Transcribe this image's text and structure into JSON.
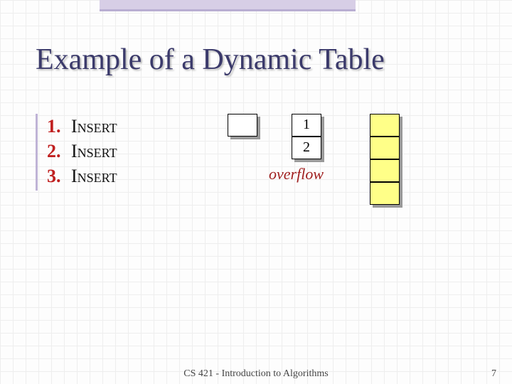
{
  "title": "Example of a Dynamic Table",
  "list": [
    {
      "num": "1.",
      "label": "Insert"
    },
    {
      "num": "2.",
      "label": "Insert"
    },
    {
      "num": "3.",
      "label": "Insert"
    }
  ],
  "cells": {
    "small": "",
    "mid_top": "1",
    "mid_bottom": "2"
  },
  "overflow_label": "overflow",
  "footer": {
    "course": "CS 421 - Introduction to Algorithms",
    "page": "7"
  }
}
